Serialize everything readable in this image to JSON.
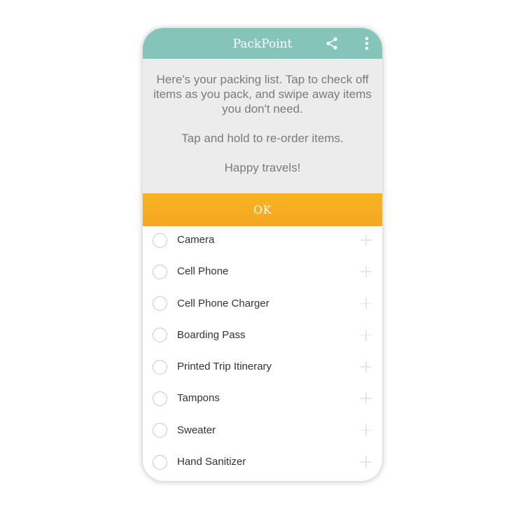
{
  "app": {
    "title": "PackPoint",
    "actions": {
      "share_icon": "share-icon",
      "more_icon": "more-vert-icon"
    },
    "colors": {
      "appbar": "#85c4b9",
      "ok_button": "#f5a623",
      "banner": "#ececec"
    }
  },
  "banner": {
    "message_1": "Here's your packing list. Tap to check off items as you pack, and swipe away items you don't need.",
    "message_2": "Tap and hold to re-order items.",
    "message_3": "Happy travels!",
    "ok_label": "OK"
  },
  "items": [
    {
      "label": "Camera",
      "checked": false
    },
    {
      "label": "Cell Phone",
      "checked": false
    },
    {
      "label": "Cell Phone Charger",
      "checked": false
    },
    {
      "label": "Boarding Pass",
      "checked": false
    },
    {
      "label": "Printed Trip Itinerary",
      "checked": false
    },
    {
      "label": "Tampons",
      "checked": false
    },
    {
      "label": "Sweater",
      "checked": false
    },
    {
      "label": "Hand Sanitizer",
      "checked": false
    }
  ]
}
